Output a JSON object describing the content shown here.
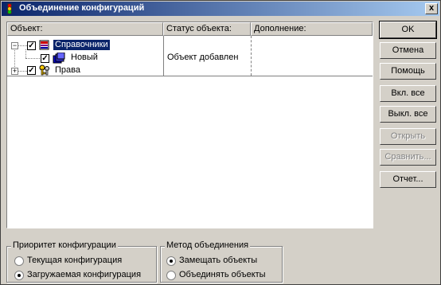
{
  "window": {
    "title": "Объединение конфигураций",
    "close_glyph": "x"
  },
  "columns": [
    "Объект:",
    "Статус объекта:",
    "Дополнение:"
  ],
  "tree": [
    {
      "label": "Справочники",
      "checked": true,
      "expanded": true,
      "selected": true,
      "icon": "book-stack-icon",
      "status": "",
      "extra": ""
    },
    {
      "label": "Новый",
      "checked": true,
      "icon": "books-icon",
      "status": "Объект добавлен",
      "extra": ""
    },
    {
      "label": "Права",
      "checked": true,
      "expanded": false,
      "icon": "keys-icon",
      "status": "",
      "extra": ""
    }
  ],
  "buttons": {
    "ok": "OK",
    "cancel": "Отмена",
    "help": "Помощь",
    "enable_all": "Вкл. все",
    "disable_all": "Выкл. все",
    "open": "Открыть",
    "compare": "Сравнить...",
    "report": "Отчет..."
  },
  "priority": {
    "legend": "Приоритет конфигурации",
    "options": [
      "Текущая конфигурация",
      "Загружаемая конфигурация"
    ],
    "selected_index": 1
  },
  "method": {
    "legend": "Метод объединения",
    "options": [
      "Замещать объекты",
      "Объединять объекты"
    ],
    "selected_index": 0
  },
  "check_glyph": "✓",
  "expand_minus": "−",
  "expand_plus": "+"
}
